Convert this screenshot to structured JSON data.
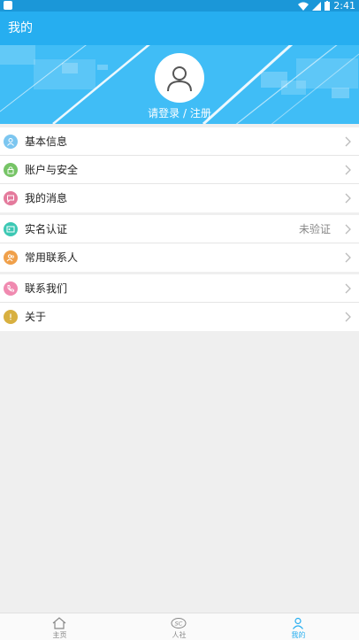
{
  "status_bar": {
    "time": "2:41"
  },
  "app_bar": {
    "title": "我的"
  },
  "profile": {
    "login_text": "请登录 / 注册"
  },
  "groups": [
    {
      "items": [
        {
          "label": "基本信息",
          "icon": "user-icon",
          "color": "#7cc6f0"
        },
        {
          "label": "账户与安全",
          "icon": "lock-icon",
          "color": "#76c466"
        },
        {
          "label": "我的消息",
          "icon": "message-icon",
          "color": "#e47a9c"
        }
      ]
    },
    {
      "items": [
        {
          "label": "实名认证",
          "value": "未验证",
          "icon": "id-card-icon",
          "color": "#3cc8b4"
        },
        {
          "label": "常用联系人",
          "icon": "contacts-icon",
          "color": "#f0a04a"
        }
      ]
    },
    {
      "items": [
        {
          "label": "联系我们",
          "icon": "phone-icon",
          "color": "#f08ab0"
        },
        {
          "label": "关于",
          "icon": "info-icon",
          "color": "#d8b040"
        }
      ]
    }
  ],
  "tabbar": {
    "tabs": [
      {
        "label": "主页",
        "icon": "home-icon"
      },
      {
        "label": "人社",
        "icon": "social-security-icon"
      },
      {
        "label": "我的",
        "icon": "person-icon",
        "active": true
      }
    ]
  },
  "colors": {
    "primary": "#26aef0",
    "status_bar": "#1b97d8",
    "banner": "#40bdf6"
  }
}
